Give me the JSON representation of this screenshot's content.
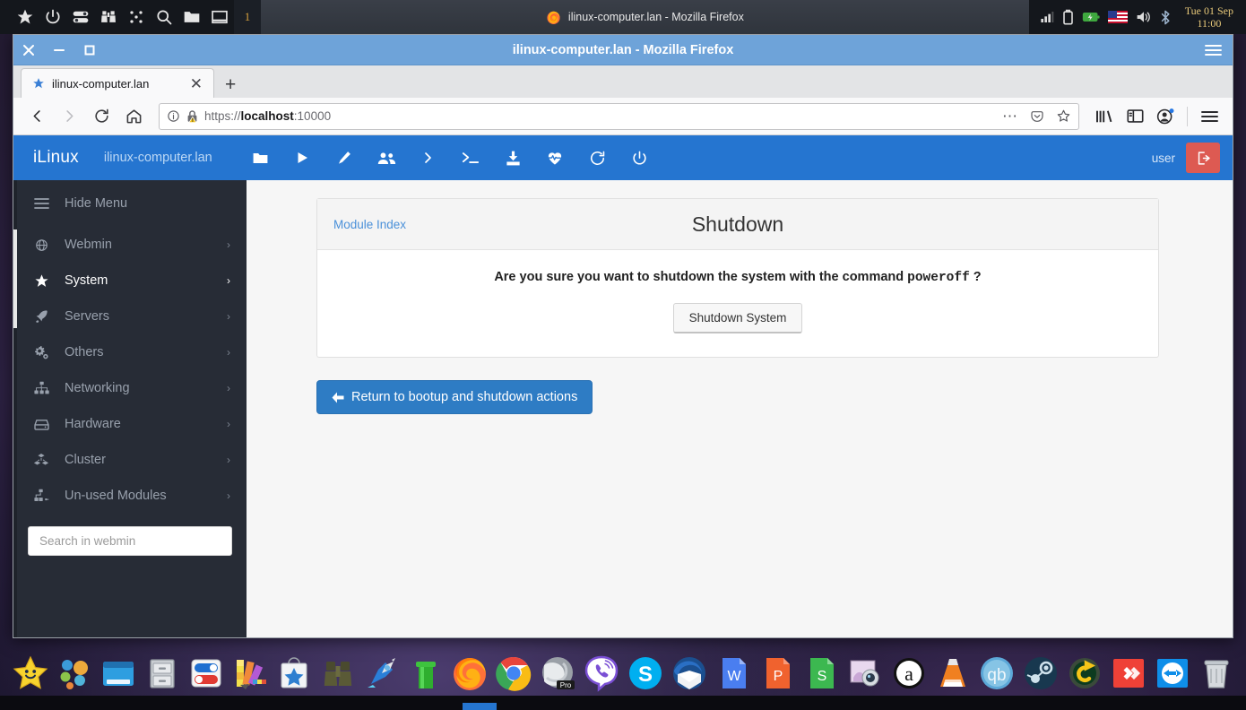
{
  "top_panel": {
    "launcher_icons": [
      "star-icon",
      "power-icon",
      "toggles-icon",
      "binoculars-icon",
      "grid-dots-icon",
      "search-icon",
      "folder-icon",
      "window-icon"
    ],
    "workspace_number": "1",
    "active_task": "ilinux-computer.lan - Mozilla Firefox",
    "tray_icons": [
      "signal-icon",
      "battery-icon",
      "charging-icon",
      "flag-us-icon",
      "volume-icon",
      "bluetooth-icon"
    ],
    "clock_date": "Tue 01 Sep",
    "clock_time": "11:00"
  },
  "firefox": {
    "window_title": "ilinux-computer.lan - Mozilla Firefox",
    "titlebar_buttons": [
      "close-icon",
      "minimize-icon",
      "maximize-icon"
    ],
    "menu_icon": "hamburger-icon",
    "tab": {
      "title": "ilinux-computer.lan",
      "favicon": "star-icon",
      "close": "✕"
    },
    "new_tab_label": "+",
    "nav": {
      "back": "←",
      "forward": "→",
      "reload": "⟳",
      "home": "⌂",
      "url_scheme": "https://",
      "url_host": "localhost",
      "url_port": ":10000",
      "url_full": "https://localhost:10000",
      "page_actions": "⋯",
      "pocket_icon": "pocket-icon",
      "bookmark_icon": "star-outline-icon",
      "library_icon": "library-icon",
      "sidebar_icon": "sidebar-icon",
      "account_icon": "account-icon",
      "menu_icon": "hamburger-icon"
    }
  },
  "webmin": {
    "brand": "iLinux",
    "hostname": "ilinux-computer.lan",
    "header_icons": [
      {
        "name": "folder-icon"
      },
      {
        "name": "play-icon"
      },
      {
        "name": "pencil-icon"
      },
      {
        "name": "users-icon"
      },
      {
        "name": "chevron-right-icon"
      },
      {
        "name": "terminal-icon"
      },
      {
        "name": "download-icon"
      },
      {
        "name": "heartbeat-icon"
      },
      {
        "name": "refresh-icon"
      },
      {
        "name": "power-icon"
      }
    ],
    "user": "user",
    "logout_icon": "logout-icon",
    "sidebar": {
      "hide_menu_label": "Hide Menu",
      "hide_menu_icon": "hamburger-icon",
      "items": [
        {
          "label": "Webmin",
          "icon": "globe-icon",
          "arrow": "›",
          "active": false
        },
        {
          "label": "System",
          "icon": "star-icon",
          "arrow": "›",
          "active": true
        },
        {
          "label": "Servers",
          "icon": "rocket-icon",
          "arrow": "›",
          "active": false
        },
        {
          "label": "Others",
          "icon": "gears-icon",
          "arrow": "›",
          "active": false
        },
        {
          "label": "Networking",
          "icon": "sitemap-icon",
          "arrow": "›",
          "active": false
        },
        {
          "label": "Hardware",
          "icon": "hard-drive-icon",
          "arrow": "›",
          "active": false
        },
        {
          "label": "Cluster",
          "icon": "cubes-icon",
          "arrow": "›",
          "active": false
        },
        {
          "label": "Un-used Modules",
          "icon": "plug-icon",
          "arrow": "›",
          "active": false
        }
      ],
      "search_placeholder": "Search in webmin"
    },
    "content": {
      "module_index_link": "Module Index",
      "title": "Shutdown",
      "confirm_prefix": "Are you sure you want to shutdown the system with the command ",
      "confirm_command": "poweroff",
      "confirm_suffix": " ?",
      "shutdown_button": "Shutdown System",
      "return_button": "Return to bootup and shutdown actions",
      "return_arrow": "←"
    }
  },
  "dock": {
    "icons": [
      "star-smiley-icon",
      "bubbles-icon",
      "window-manager-icon",
      "file-cabinet-icon",
      "toggles-icon",
      "color-palette-icon",
      "software-store-icon",
      "binoculars-icon",
      "rocket-icon",
      "pipe-icon",
      "firefox-icon",
      "chrome-icon",
      "opera-pro-icon",
      "viber-icon",
      "skype-icon",
      "thunderbird-icon",
      "wps-writer-icon",
      "wps-presentation-icon",
      "wps-spreadsheet-icon",
      "screenshot-icon",
      "audacious-icon",
      "vlc-icon",
      "qbittorrent-icon",
      "steam-icon",
      "timeshift-icon",
      "anydesk-icon",
      "teamviewer-icon",
      "trash-icon"
    ]
  },
  "colors": {
    "webmin_blue": "#2575d0",
    "sidebar_dark": "#272c36",
    "titlebar_blue": "#6ea3d9",
    "logout_red": "#dd5a52",
    "link_blue": "#4a90d9",
    "return_btn_blue": "#2e7cc4"
  }
}
